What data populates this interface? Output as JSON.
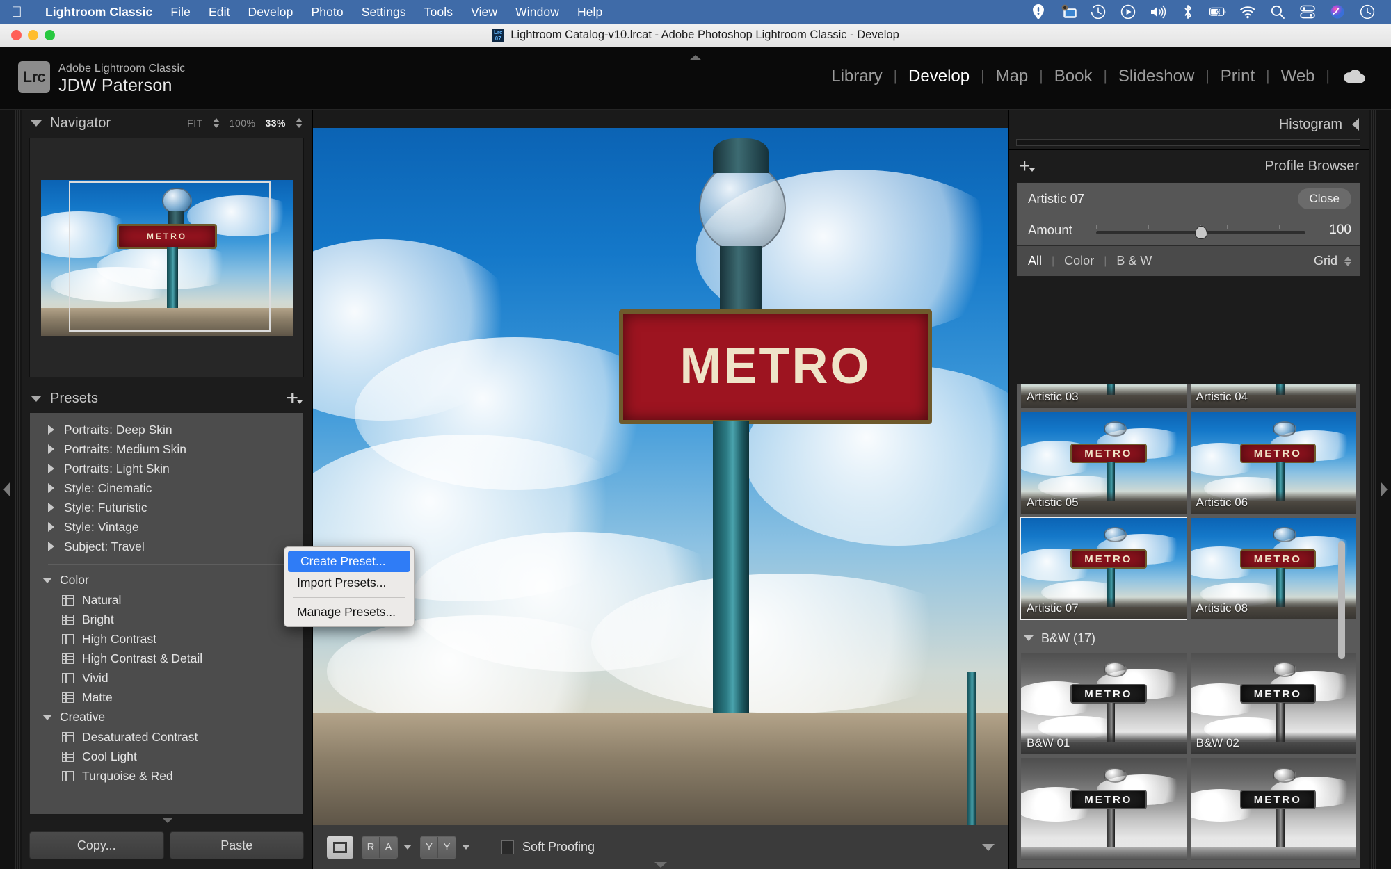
{
  "menubar": {
    "apple_icon": "apple-logo",
    "items": [
      {
        "label": "Lightroom Classic",
        "bold": true
      },
      {
        "label": "File"
      },
      {
        "label": "Edit"
      },
      {
        "label": "Develop"
      },
      {
        "label": "Photo"
      },
      {
        "label": "Settings"
      },
      {
        "label": "Tools"
      },
      {
        "label": "View"
      },
      {
        "label": "Window"
      },
      {
        "label": "Help"
      }
    ],
    "tray_icons": [
      "alert-icon",
      "screen-sharing-icon",
      "time-machine-icon",
      "now-playing-icon",
      "volume-icon",
      "bluetooth-icon",
      "battery-charging-icon",
      "wifi-icon",
      "spotlight-search-icon",
      "control-center-icon",
      "siri-icon",
      "clock-icon"
    ]
  },
  "titlebar": {
    "title": "Lightroom Catalog-v10.lrcat - Adobe Photoshop Lightroom Classic - Develop",
    "app_icon_top": "Lrc",
    "app_icon_bottom": "07"
  },
  "identity": {
    "badge": "Lrc",
    "product": "Adobe Lightroom Classic",
    "user": "JDW Paterson"
  },
  "modules": {
    "items": [
      {
        "label": "Library",
        "active": false
      },
      {
        "label": "Develop",
        "active": true
      },
      {
        "label": "Map",
        "active": false
      },
      {
        "label": "Book",
        "active": false
      },
      {
        "label": "Slideshow",
        "active": false
      },
      {
        "label": "Print",
        "active": false
      },
      {
        "label": "Web",
        "active": false
      }
    ],
    "separator": "|",
    "cloud_icon": "cloud-sync-icon"
  },
  "navigator": {
    "title": "Navigator",
    "zoom_fit": "FIT",
    "zoom_100": "100%",
    "zoom_current": "33%"
  },
  "presets": {
    "title": "Presets",
    "add_label": "+",
    "groups": [
      {
        "label": "Portraits: Deep Skin"
      },
      {
        "label": "Portraits: Medium Skin"
      },
      {
        "label": "Portraits: Light Skin"
      },
      {
        "label": "Style: Cinematic"
      },
      {
        "label": "Style: Futuristic"
      },
      {
        "label": "Style: Vintage"
      },
      {
        "label": "Subject: Travel"
      }
    ],
    "sections": [
      {
        "label": "Color",
        "items": [
          "Natural",
          "Bright",
          "High Contrast",
          "High Contrast & Detail",
          "Vivid",
          "Matte"
        ]
      },
      {
        "label": "Creative",
        "items": [
          "Desaturated Contrast",
          "Cool Light",
          "Turquoise & Red"
        ]
      }
    ],
    "copy_label": "Copy...",
    "paste_label": "Paste"
  },
  "context_menu": {
    "items": [
      {
        "label": "Create Preset...",
        "selected": true
      },
      {
        "label": "Import Presets...",
        "selected": false
      },
      {
        "label": "Manage Presets...",
        "selected": false
      }
    ]
  },
  "toolbar": {
    "view_icon": "loupe-view-icon",
    "seg1": [
      "R",
      "A"
    ],
    "seg2": [
      "Y",
      "Y"
    ],
    "soft_proofing_label": "Soft Proofing",
    "soft_proofing_checkbox": "checkbox-unchecked-icon",
    "expand_icon": "chevron-down-icon"
  },
  "histogram": {
    "title": "Histogram",
    "collapse_icon": "triangle-left-icon"
  },
  "profile_browser": {
    "title": "Profile Browser",
    "add_icon": "plus-dropdown-icon",
    "selected_profile": "Artistic 07",
    "close_label": "Close",
    "amount_label": "Amount",
    "amount_value": "100",
    "amount_percent": 50,
    "filters": [
      {
        "label": "All",
        "active": true
      },
      {
        "label": "Color",
        "active": false
      },
      {
        "label": "B & W",
        "active": false
      }
    ],
    "view_mode": "Grid",
    "thumb_rows": [
      {
        "items": [
          {
            "label": "Artistic 03",
            "selected": false,
            "bw": false
          },
          {
            "label": "Artistic 04",
            "selected": false,
            "bw": false
          }
        ]
      },
      {
        "items": [
          {
            "label": "Artistic 05",
            "selected": false,
            "bw": false
          },
          {
            "label": "Artistic 06",
            "selected": false,
            "bw": false
          }
        ]
      },
      {
        "items": [
          {
            "label": "Artistic 07",
            "selected": true,
            "bw": false
          },
          {
            "label": "Artistic 08",
            "selected": false,
            "bw": false
          }
        ]
      }
    ],
    "group_header": "B&W (17)",
    "bw_rows": [
      {
        "items": [
          {
            "label": "B&W 01",
            "selected": false,
            "bw": true
          },
          {
            "label": "B&W 02",
            "selected": false,
            "bw": true
          }
        ]
      },
      {
        "items": [
          {
            "label": "",
            "selected": false,
            "bw": true
          },
          {
            "label": "",
            "selected": false,
            "bw": true
          }
        ]
      }
    ]
  },
  "photo": {
    "sign_text": "METRO",
    "alt": "Paris Metro sign against blue sky with clouds"
  },
  "colors": {
    "menubar_blue": "#3f6ba8",
    "accent_blue": "#2f7cf6",
    "panel_bg": "#1c1c1c",
    "preset_list_bg": "#4c4c4c",
    "sign_red": "#9d1420"
  }
}
